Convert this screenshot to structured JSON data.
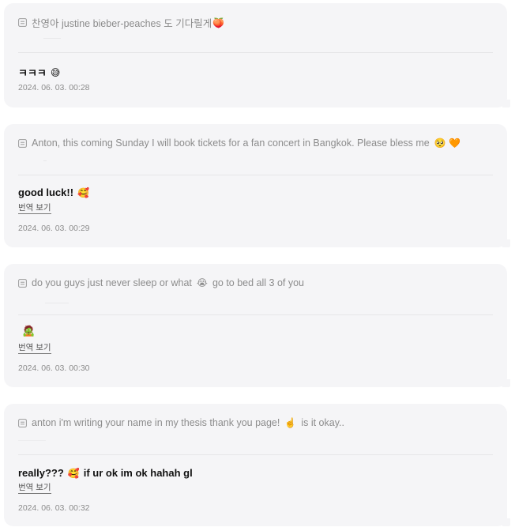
{
  "posts": [
    {
      "question": "찬영아 justine bieber-peaches 도 기다릴게",
      "question_emoji": "🍑",
      "answer": "ㅋㅋㅋ",
      "answer_emoji": "😅",
      "translate": "",
      "date": "2024. 06. 03. 00:28"
    },
    {
      "question": "Anton, this coming Sunday I will book tickets for a fan concert in Bangkok. Please bless me",
      "question_emoji": "🥺 🧡",
      "answer": "good luck!!",
      "answer_emoji": "🥰",
      "translate": "번역 보기",
      "date": "2024. 06. 03. 00:29"
    },
    {
      "question": "do you guys just never sleep or what",
      "question_emoji": "😭",
      "question_tail": "go to bed all 3 of you",
      "answer": "",
      "answer_emoji": "🧟",
      "translate": "번역 보기",
      "date": "2024. 06. 03. 00:30"
    },
    {
      "question": "anton i'm writing your name in my thesis thank you page!",
      "question_emoji": "☝️",
      "question_tail": "is it okay..",
      "answer": "really???",
      "answer_emoji": "🥰",
      "answer_tail": "if ur ok im ok hahah gl",
      "translate": "번역 보기",
      "date": "2024. 06. 03. 00:32"
    }
  ]
}
